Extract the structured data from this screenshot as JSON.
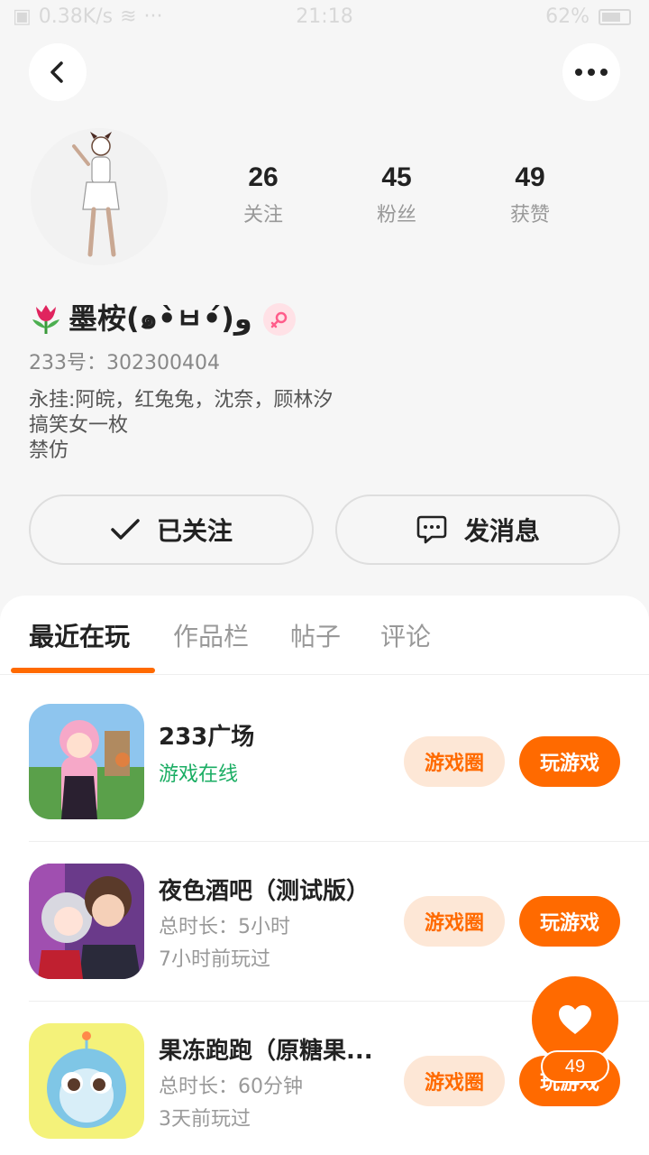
{
  "status_bar": {
    "net_speed": "0.38K/s",
    "time": "21:18",
    "battery": "62%"
  },
  "profile": {
    "name": "墨桉(๑•̀ㅂ•́)و",
    "uid": "233号：302300404",
    "bio": [
      "永挂:阿皖，红兔兔，沈奈，顾林汐",
      "搞笑女一枚",
      "禁仿"
    ],
    "stats": [
      {
        "num": "26",
        "label": "关注"
      },
      {
        "num": "45",
        "label": "粉丝"
      },
      {
        "num": "49",
        "label": "获赞"
      }
    ]
  },
  "actions": {
    "follow_label": "已关注",
    "message_label": "发消息"
  },
  "tabs": [
    "最近在玩",
    "作品栏",
    "帖子",
    "评论"
  ],
  "games": [
    {
      "title": "233广场",
      "line1": "游戏在线",
      "line2": "",
      "circle": "游戏圈",
      "play": "玩游戏"
    },
    {
      "title": "夜色酒吧（测试版）",
      "line1": "总时长：5小时",
      "line2": "7小时前玩过",
      "circle": "游戏圈",
      "play": "玩游戏"
    },
    {
      "title": "果冻跑跑（原糖果...",
      "line1": "总时长：60分钟",
      "line2": "3天前玩过",
      "circle": "游戏圈",
      "play": "玩游戏"
    }
  ],
  "like": {
    "count": "49"
  },
  "colors": {
    "accent": "#ff6a00",
    "online": "#1aad63",
    "pill_bg": "#fde7d6"
  }
}
